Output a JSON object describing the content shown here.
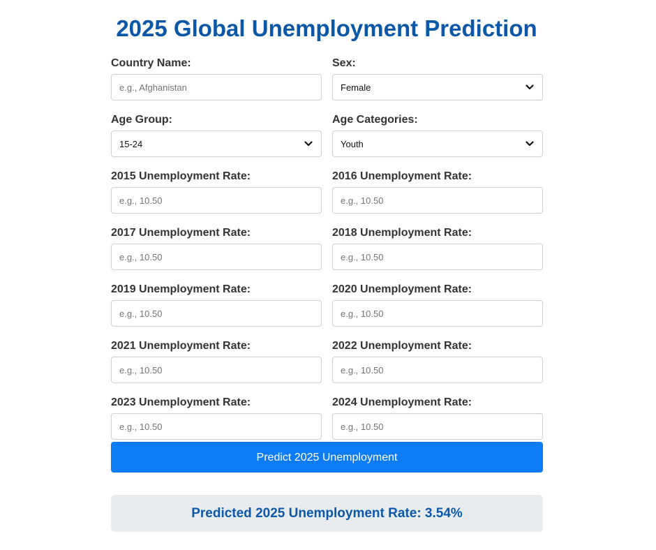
{
  "title": "2025 Global Unemployment Prediction",
  "form": {
    "country": {
      "label": "Country Name:",
      "placeholder": "e.g., Afghanistan"
    },
    "sex": {
      "label": "Sex:",
      "selected": "Female"
    },
    "age_group": {
      "label": "Age Group:",
      "selected": "15-24"
    },
    "age_categories": {
      "label": "Age Categories:",
      "selected": "Youth"
    },
    "rates": [
      {
        "label": "2015 Unemployment Rate:",
        "placeholder": "e.g., 10.50"
      },
      {
        "label": "2016 Unemployment Rate:",
        "placeholder": "e.g., 10.50"
      },
      {
        "label": "2017 Unemployment Rate:",
        "placeholder": "e.g., 10.50"
      },
      {
        "label": "2018 Unemployment Rate:",
        "placeholder": "e.g., 10.50"
      },
      {
        "label": "2019 Unemployment Rate:",
        "placeholder": "e.g., 10.50"
      },
      {
        "label": "2020 Unemployment Rate:",
        "placeholder": "e.g., 10.50"
      },
      {
        "label": "2021 Unemployment Rate:",
        "placeholder": "e.g., 10.50"
      },
      {
        "label": "2022 Unemployment Rate:",
        "placeholder": "e.g., 10.50"
      },
      {
        "label": "2023 Unemployment Rate:",
        "placeholder": "e.g., 10.50"
      },
      {
        "label": "2024 Unemployment Rate:",
        "placeholder": "e.g., 10.50"
      }
    ]
  },
  "predict_button": "Predict 2025 Unemployment",
  "result_text": "Predicted 2025 Unemployment Rate: 3.54%",
  "icons": {
    "dropdown": "chevron-down-icon"
  },
  "colors": {
    "title": "#0b57a8",
    "button": "#0d7bf2",
    "result_bg": "#e9ecef",
    "result_text": "#0b57a8"
  }
}
